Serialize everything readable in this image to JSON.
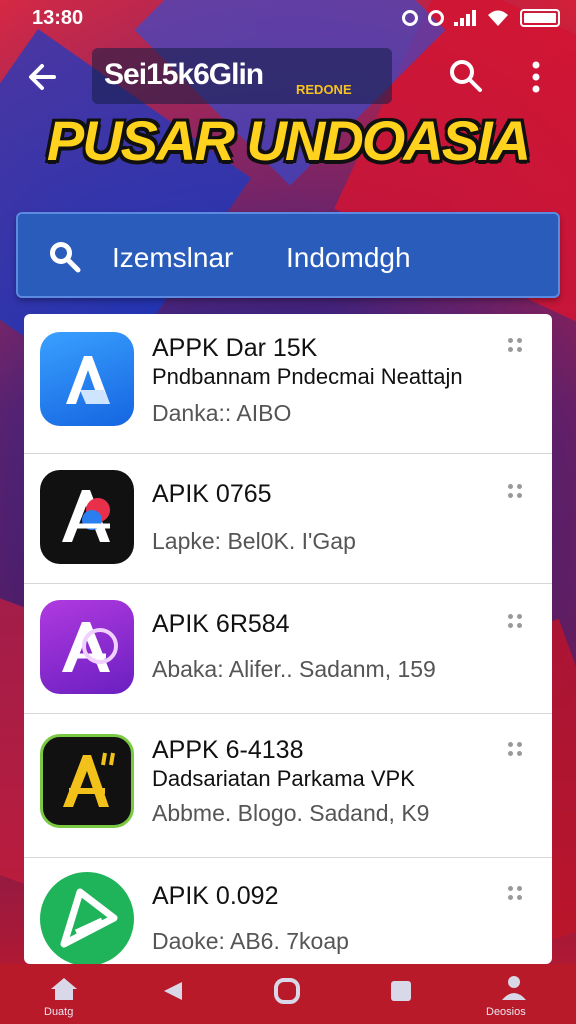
{
  "status_bar": {
    "time": "13:80"
  },
  "app_bar": {
    "title": "Sei15k6Glin",
    "subtitle": "REDONE"
  },
  "banner": {
    "title": "PUSAR UNDOASIA"
  },
  "search_header": {
    "text1": "Izemslnar",
    "text2": "Indomdgh"
  },
  "apps": [
    {
      "title": "APPK Dar 15K",
      "subtitle": "Pndbannam Pndecmai Neattajn",
      "meta": "Danka:: AIBO",
      "icon": "a-blue-app-icon",
      "color": "#1a86f2"
    },
    {
      "title": "APIK 0765",
      "subtitle": "",
      "meta": "Lapke: Bel0K. I'Gap",
      "icon": "a-black-app-icon",
      "color": "#111111"
    },
    {
      "title": "APIK 6R584",
      "subtitle": "",
      "meta": "Abaka: Alifer.. Sadanm, 159",
      "icon": "a-purple-app-icon",
      "color": "#7a2ac8"
    },
    {
      "title": "APPK 6-4138",
      "subtitle": "Dadsariatan Parkama VPK",
      "meta": "Abbme. Blogo. Sadand, K9",
      "icon": "a-yellow-app-icon",
      "color": "#f2c21b"
    },
    {
      "title": "APIK 0.092",
      "subtitle": "",
      "meta": "Daoke: AB6. 7koap",
      "icon": "a-green-app-icon",
      "color": "#1fb45a"
    }
  ],
  "bottom_nav": {
    "home_label": "Duatg",
    "back_label": "",
    "recents_label": "",
    "overview_label": "",
    "profile_label": "Deosios"
  }
}
